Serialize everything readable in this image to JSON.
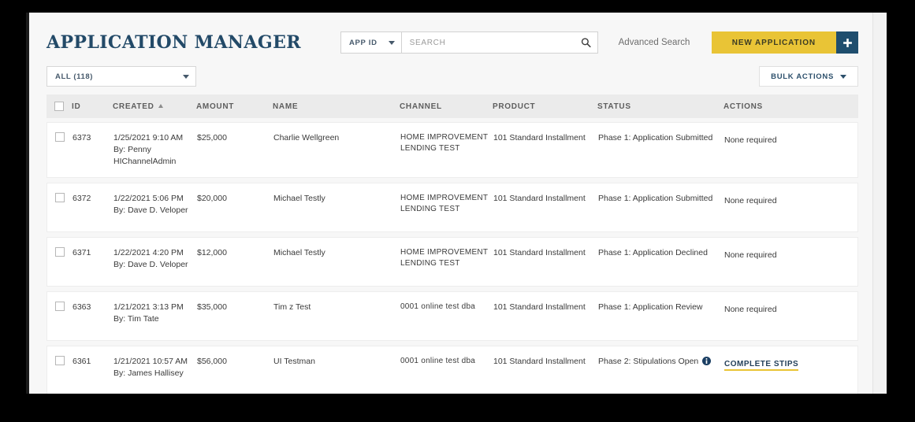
{
  "header": {
    "title": "APPLICATION MANAGER",
    "search_scope": "APP ID",
    "search_placeholder": "SEARCH",
    "search_value": "",
    "search_icon": "search-icon",
    "advanced_search": "Advanced Search",
    "new_application_label": "NEW APPLICATION",
    "plus_icon": "plus-icon"
  },
  "filters": {
    "status_filter": "ALL (118)",
    "bulk_actions_label": "BULK ACTIONS",
    "chevron_icon": "chevron-down-icon"
  },
  "table": {
    "columns": {
      "select": "",
      "id": "ID",
      "created": "CREATED",
      "amount": "AMOUNT",
      "name": "NAME",
      "channel": "CHANNEL",
      "product": "PRODUCT",
      "status": "STATUS",
      "actions": "ACTIONS"
    },
    "sort_column": "CREATED",
    "sort_direction": "asc",
    "rows": [
      {
        "id": "6373",
        "created_date": "1/25/2021 9:10 AM",
        "created_by": "By: Penny HIChannelAdmin",
        "amount": "$25,000",
        "name": "Charlie Wellgreen",
        "channel": "HOME IMPROVEMENT LENDING TEST",
        "product": "101 Standard Installment",
        "status": "Phase 1: Application Submitted",
        "status_has_info": false,
        "action": "None required",
        "action_is_link": false
      },
      {
        "id": "6372",
        "created_date": "1/22/2021 5:06 PM",
        "created_by": "By: Dave D. Veloper",
        "amount": "$20,000",
        "name": "Michael Testly",
        "channel": "HOME IMPROVEMENT LENDING TEST",
        "product": "101 Standard Installment",
        "status": "Phase 1: Application Submitted",
        "status_has_info": false,
        "action": "None required",
        "action_is_link": false
      },
      {
        "id": "6371",
        "created_date": "1/22/2021 4:20 PM",
        "created_by": "By: Dave D. Veloper",
        "amount": "$12,000",
        "name": "Michael Testly",
        "channel": "HOME IMPROVEMENT LENDING TEST",
        "product": "101 Standard Installment",
        "status": "Phase 1: Application Declined",
        "status_has_info": false,
        "action": "None required",
        "action_is_link": false
      },
      {
        "id": "6363",
        "created_date": "1/21/2021 3:13 PM",
        "created_by": "By: Tim Tate",
        "amount": "$35,000",
        "name": "Tim z Test",
        "channel": "0001 online test dba",
        "product": "101 Standard Installment",
        "status": "Phase 1: Application Review",
        "status_has_info": false,
        "action": "None required",
        "action_is_link": false
      },
      {
        "id": "6361",
        "created_date": "1/21/2021 10:57 AM",
        "created_by": "By: James Hallisey",
        "amount": "$56,000",
        "name": "UI Testman",
        "channel": "0001 online test dba",
        "product": "101 Standard Installment",
        "status": "Phase 2: Stipulations Open",
        "status_has_info": true,
        "action": "COMPLETE STIPS",
        "action_is_link": true
      }
    ]
  },
  "colors": {
    "navy": "#1f4e6e",
    "title_navy": "#234a68",
    "yellow": "#e9c436",
    "page_bg": "#f7f7f7",
    "header_row_bg": "#ebebeb",
    "row_bg": "#ffffff"
  }
}
